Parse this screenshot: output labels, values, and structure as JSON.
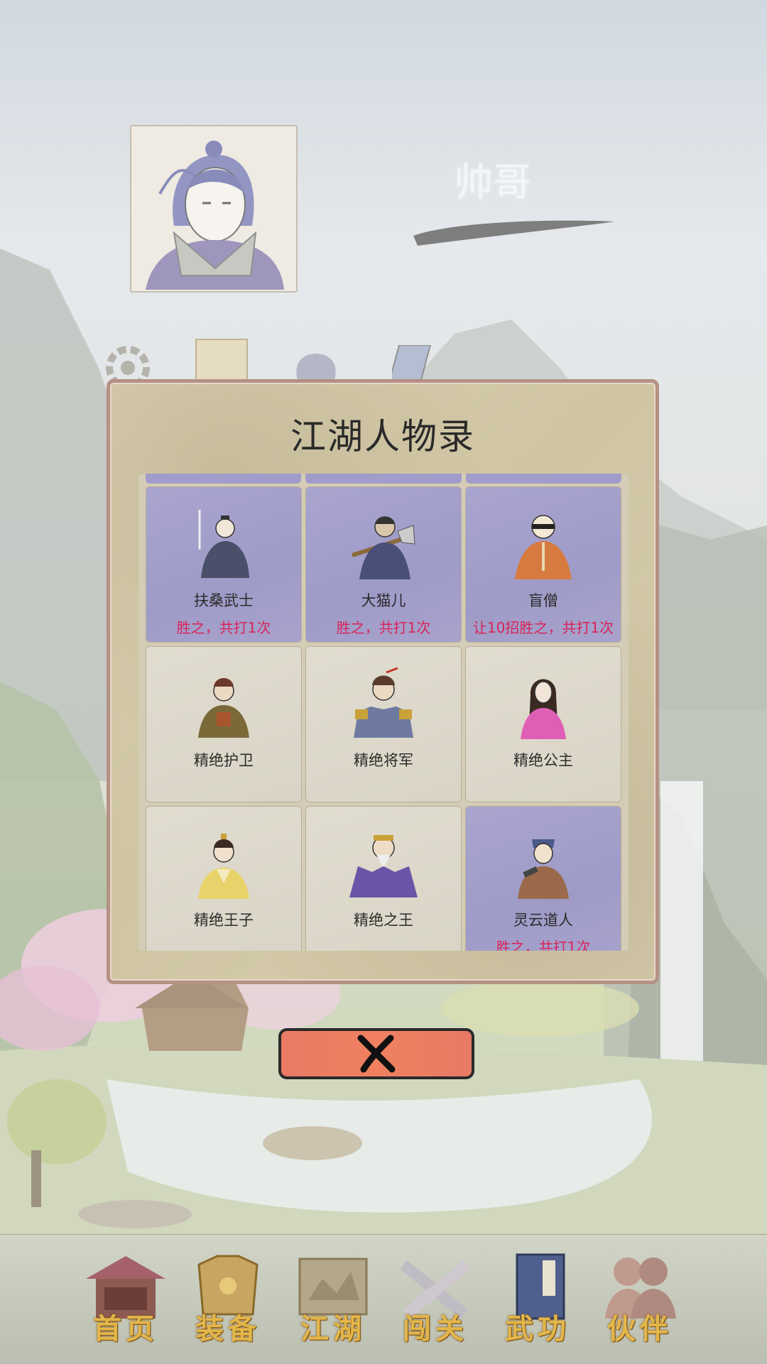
{
  "player": {
    "name": "帅哥"
  },
  "modal": {
    "title": "江湖人物录",
    "characters": [
      {
        "name": "扶桑武士",
        "record": "胜之，共打1次",
        "won": true,
        "icon": "samurai-portrait-icon"
      },
      {
        "name": "大猫儿",
        "record": "胜之，共打1次",
        "won": true,
        "icon": "axe-man-portrait-icon"
      },
      {
        "name": "盲僧",
        "record": "让10招胜之，共打1次",
        "won": true,
        "icon": "blind-monk-portrait-icon"
      },
      {
        "name": "精绝护卫",
        "record": "",
        "won": false,
        "icon": "guard-portrait-icon"
      },
      {
        "name": "精绝将军",
        "record": "",
        "won": false,
        "icon": "general-portrait-icon"
      },
      {
        "name": "精绝公主",
        "record": "",
        "won": false,
        "icon": "princess-portrait-icon"
      },
      {
        "name": "精绝王子",
        "record": "",
        "won": false,
        "icon": "prince-portrait-icon"
      },
      {
        "name": "精绝之王",
        "record": "",
        "won": false,
        "icon": "king-portrait-icon"
      },
      {
        "name": "灵云道人",
        "record": "胜之，共打1次",
        "won": true,
        "icon": "taoist-portrait-icon"
      }
    ],
    "close_icon": "close-x-icon"
  },
  "nav": {
    "items": [
      {
        "label": "首页",
        "icon": "house-icon",
        "active": true
      },
      {
        "label": "装备",
        "icon": "armor-icon"
      },
      {
        "label": "江湖",
        "icon": "scroll-map-icon"
      },
      {
        "label": "闯关",
        "icon": "crossed-swords-icon"
      },
      {
        "label": "武功",
        "icon": "book-icon"
      },
      {
        "label": "伙伴",
        "icon": "companions-icon"
      }
    ]
  },
  "colors": {
    "won_card": "#a19dc9",
    "plain_card": "#dcd8cb",
    "record_text": "#d8245a",
    "nav_label": "#e3b64a",
    "close_button": "#ef7d62"
  }
}
